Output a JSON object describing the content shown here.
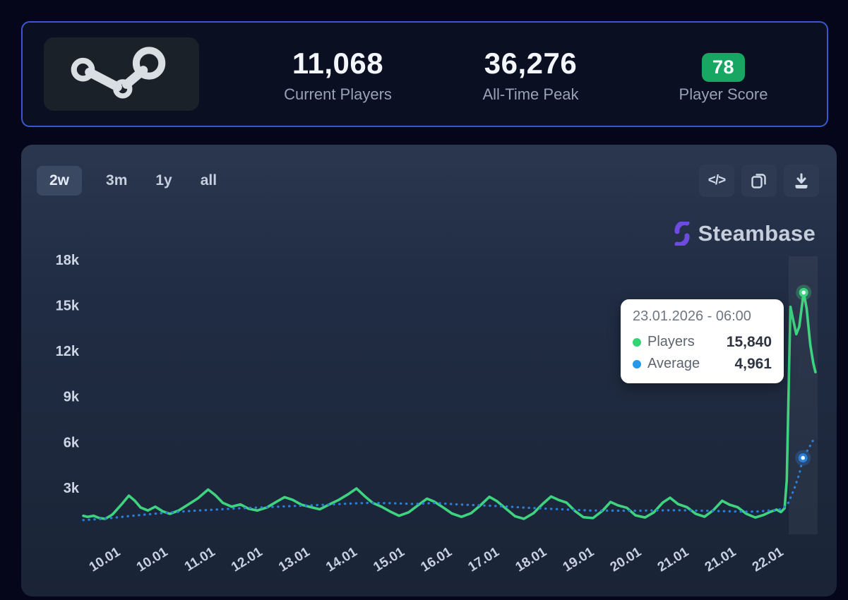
{
  "stats_card": {
    "stats": [
      {
        "value": "11,068",
        "label": "Current Players"
      },
      {
        "value": "36,276",
        "label": "All-Time Peak"
      },
      {
        "value": "78",
        "label": "Player Score"
      }
    ],
    "badge_color": "#18a663",
    "border_color": "#3659cf"
  },
  "chart_panel": {
    "range_buttons": [
      {
        "label": "2w",
        "selected": true
      },
      {
        "label": "3m",
        "selected": false
      },
      {
        "label": "1y",
        "selected": false
      },
      {
        "label": "all",
        "selected": false
      }
    ],
    "action_buttons": [
      {
        "icon": "embed-code-icon"
      },
      {
        "icon": "copy-icon"
      },
      {
        "icon": "download-icon"
      }
    ],
    "brand": {
      "name": "Steambase",
      "icon_color": "#6d4be0"
    },
    "tooltip": {
      "title": "23.01.2026 - 06:00",
      "rows": [
        {
          "label": "Players",
          "value": "15,840",
          "color": "#34d474"
        },
        {
          "label": "Average",
          "value": "4,961",
          "color": "#2499ea"
        }
      ]
    }
  },
  "chart_data": {
    "type": "line",
    "title": "Steam concurrent players, last 2 weeks",
    "x_unit": "fraction of visible 2-week range",
    "y_ticks": [
      "3k",
      "6k",
      "9k",
      "12k",
      "15k",
      "18k"
    ],
    "y_tick_values": [
      3000,
      6000,
      9000,
      12000,
      15000,
      18000
    ],
    "x_ticks": [
      "10.01",
      "10.01",
      "11.01",
      "12.01",
      "13.01",
      "14.01",
      "15.01",
      "16.01",
      "17.01",
      "18.01",
      "19.01",
      "20.01",
      "21.01",
      "21.01",
      "22.01"
    ],
    "ylim": [
      0,
      19000
    ],
    "grid": false,
    "legend_position": "tooltip",
    "series": [
      {
        "name": "Players",
        "color": "#3fd37f",
        "style": "solid",
        "highlight_point": {
          "x": 0.981,
          "value": 15840
        },
        "points": [
          [
            0.0,
            1150
          ],
          [
            0.006,
            1080
          ],
          [
            0.014,
            1150
          ],
          [
            0.022,
            1000
          ],
          [
            0.03,
            950
          ],
          [
            0.04,
            1250
          ],
          [
            0.052,
            1900
          ],
          [
            0.062,
            2480
          ],
          [
            0.07,
            2150
          ],
          [
            0.078,
            1700
          ],
          [
            0.088,
            1500
          ],
          [
            0.098,
            1750
          ],
          [
            0.108,
            1450
          ],
          [
            0.118,
            1280
          ],
          [
            0.13,
            1500
          ],
          [
            0.143,
            1900
          ],
          [
            0.156,
            2300
          ],
          [
            0.17,
            2880
          ],
          [
            0.18,
            2500
          ],
          [
            0.19,
            2000
          ],
          [
            0.202,
            1750
          ],
          [
            0.214,
            1900
          ],
          [
            0.225,
            1620
          ],
          [
            0.237,
            1500
          ],
          [
            0.25,
            1700
          ],
          [
            0.262,
            2050
          ],
          [
            0.274,
            2380
          ],
          [
            0.285,
            2200
          ],
          [
            0.297,
            1880
          ],
          [
            0.31,
            1720
          ],
          [
            0.322,
            1580
          ],
          [
            0.335,
            1900
          ],
          [
            0.348,
            2200
          ],
          [
            0.36,
            2550
          ],
          [
            0.372,
            2950
          ],
          [
            0.383,
            2450
          ],
          [
            0.394,
            2000
          ],
          [
            0.406,
            1750
          ],
          [
            0.418,
            1430
          ],
          [
            0.43,
            1150
          ],
          [
            0.443,
            1380
          ],
          [
            0.456,
            1850
          ],
          [
            0.468,
            2280
          ],
          [
            0.478,
            2080
          ],
          [
            0.49,
            1700
          ],
          [
            0.502,
            1300
          ],
          [
            0.515,
            1080
          ],
          [
            0.528,
            1320
          ],
          [
            0.541,
            1850
          ],
          [
            0.553,
            2400
          ],
          [
            0.563,
            2120
          ],
          [
            0.576,
            1600
          ],
          [
            0.588,
            1120
          ],
          [
            0.6,
            950
          ],
          [
            0.613,
            1320
          ],
          [
            0.626,
            1950
          ],
          [
            0.637,
            2420
          ],
          [
            0.648,
            2180
          ],
          [
            0.658,
            2020
          ],
          [
            0.67,
            1450
          ],
          [
            0.681,
            1060
          ],
          [
            0.694,
            1000
          ],
          [
            0.707,
            1480
          ],
          [
            0.718,
            2060
          ],
          [
            0.728,
            1840
          ],
          [
            0.74,
            1680
          ],
          [
            0.752,
            1180
          ],
          [
            0.765,
            1040
          ],
          [
            0.777,
            1380
          ],
          [
            0.789,
            2020
          ],
          [
            0.799,
            2340
          ],
          [
            0.81,
            1920
          ],
          [
            0.822,
            1720
          ],
          [
            0.834,
            1280
          ],
          [
            0.846,
            1090
          ],
          [
            0.858,
            1520
          ],
          [
            0.87,
            2140
          ],
          [
            0.88,
            1880
          ],
          [
            0.891,
            1720
          ],
          [
            0.903,
            1280
          ],
          [
            0.915,
            1040
          ],
          [
            0.926,
            1200
          ],
          [
            0.936,
            1420
          ],
          [
            0.944,
            1560
          ],
          [
            0.95,
            1400
          ],
          [
            0.955,
            1650
          ],
          [
            0.958,
            3500
          ],
          [
            0.961,
            10500
          ],
          [
            0.963,
            14900
          ],
          [
            0.966,
            14200
          ],
          [
            0.971,
            13100
          ],
          [
            0.975,
            13600
          ],
          [
            0.981,
            15840
          ],
          [
            0.985,
            14800
          ],
          [
            0.99,
            12400
          ],
          [
            0.994,
            11200
          ],
          [
            0.997,
            10600
          ]
        ]
      },
      {
        "name": "Average",
        "color": "#2b7fd6",
        "style": "dotted",
        "highlight_point": {
          "x": 0.98,
          "value": 4961
        },
        "points": [
          [
            0.0,
            870
          ],
          [
            0.03,
            960
          ],
          [
            0.06,
            1120
          ],
          [
            0.09,
            1260
          ],
          [
            0.12,
            1380
          ],
          [
            0.15,
            1480
          ],
          [
            0.18,
            1560
          ],
          [
            0.21,
            1640
          ],
          [
            0.24,
            1700
          ],
          [
            0.27,
            1760
          ],
          [
            0.3,
            1820
          ],
          [
            0.33,
            1880
          ],
          [
            0.36,
            1950
          ],
          [
            0.39,
            2000
          ],
          [
            0.42,
            1980
          ],
          [
            0.45,
            1930
          ],
          [
            0.48,
            1990
          ],
          [
            0.51,
            1900
          ],
          [
            0.54,
            1840
          ],
          [
            0.57,
            1780
          ],
          [
            0.6,
            1690
          ],
          [
            0.63,
            1620
          ],
          [
            0.66,
            1560
          ],
          [
            0.69,
            1500
          ],
          [
            0.72,
            1490
          ],
          [
            0.75,
            1480
          ],
          [
            0.78,
            1510
          ],
          [
            0.81,
            1520
          ],
          [
            0.84,
            1490
          ],
          [
            0.87,
            1460
          ],
          [
            0.9,
            1420
          ],
          [
            0.92,
            1440
          ],
          [
            0.94,
            1520
          ],
          [
            0.952,
            1600
          ],
          [
            0.96,
            2000
          ],
          [
            0.968,
            2900
          ],
          [
            0.975,
            3900
          ],
          [
            0.98,
            4961
          ],
          [
            0.988,
            5600
          ],
          [
            0.993,
            6050
          ],
          [
            0.997,
            6350
          ]
        ]
      }
    ]
  }
}
